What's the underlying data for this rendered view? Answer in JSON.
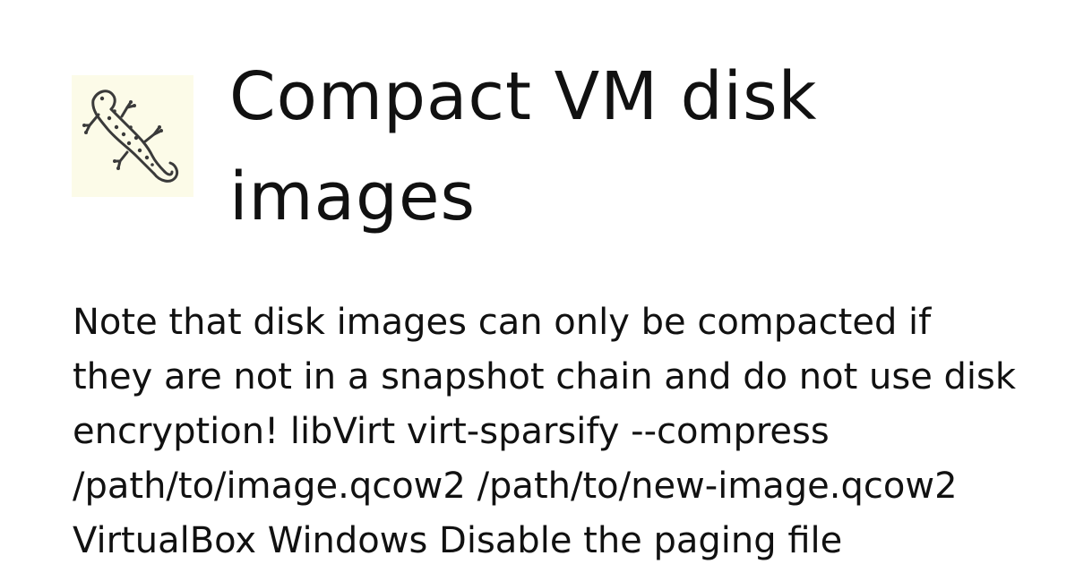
{
  "header": {
    "logo_icon": "gecko-lizard-icon",
    "title": "Compact VM disk images"
  },
  "content": {
    "excerpt": "Note that disk images can only be compacted if they are not in a snapshot chain and do not use disk encryption! libVirt virt-sparsify --compress /path/to/image.qcow2 /path/to/new-image.qcow2 VirtualBox Windows Disable the paging file"
  },
  "colors": {
    "background": "#ffffff",
    "text": "#111111",
    "logo_background": "#fcfbe8",
    "logo_stroke": "#3a3a3a"
  }
}
